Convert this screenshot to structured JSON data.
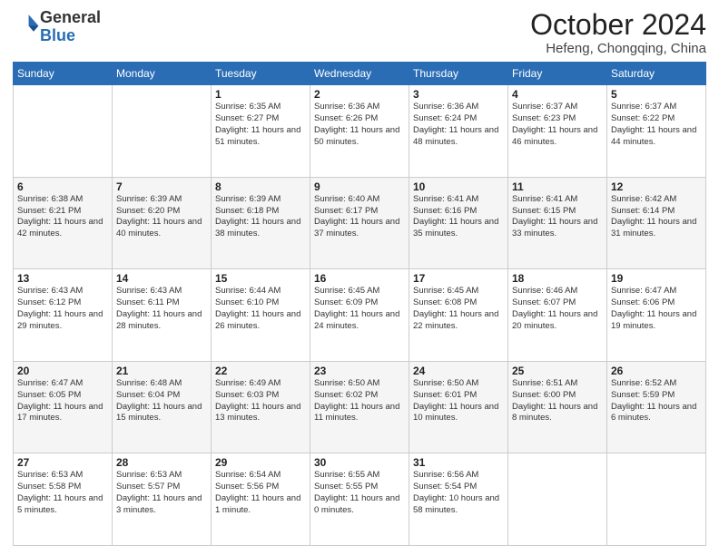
{
  "header": {
    "logo_general": "General",
    "logo_blue": "Blue",
    "month": "October 2024",
    "location": "Hefeng, Chongqing, China"
  },
  "weekdays": [
    "Sunday",
    "Monday",
    "Tuesday",
    "Wednesday",
    "Thursday",
    "Friday",
    "Saturday"
  ],
  "weeks": [
    [
      {
        "day": "",
        "info": ""
      },
      {
        "day": "",
        "info": ""
      },
      {
        "day": "1",
        "info": "Sunrise: 6:35 AM\nSunset: 6:27 PM\nDaylight: 11 hours and 51 minutes."
      },
      {
        "day": "2",
        "info": "Sunrise: 6:36 AM\nSunset: 6:26 PM\nDaylight: 11 hours and 50 minutes."
      },
      {
        "day": "3",
        "info": "Sunrise: 6:36 AM\nSunset: 6:24 PM\nDaylight: 11 hours and 48 minutes."
      },
      {
        "day": "4",
        "info": "Sunrise: 6:37 AM\nSunset: 6:23 PM\nDaylight: 11 hours and 46 minutes."
      },
      {
        "day": "5",
        "info": "Sunrise: 6:37 AM\nSunset: 6:22 PM\nDaylight: 11 hours and 44 minutes."
      }
    ],
    [
      {
        "day": "6",
        "info": "Sunrise: 6:38 AM\nSunset: 6:21 PM\nDaylight: 11 hours and 42 minutes."
      },
      {
        "day": "7",
        "info": "Sunrise: 6:39 AM\nSunset: 6:20 PM\nDaylight: 11 hours and 40 minutes."
      },
      {
        "day": "8",
        "info": "Sunrise: 6:39 AM\nSunset: 6:18 PM\nDaylight: 11 hours and 38 minutes."
      },
      {
        "day": "9",
        "info": "Sunrise: 6:40 AM\nSunset: 6:17 PM\nDaylight: 11 hours and 37 minutes."
      },
      {
        "day": "10",
        "info": "Sunrise: 6:41 AM\nSunset: 6:16 PM\nDaylight: 11 hours and 35 minutes."
      },
      {
        "day": "11",
        "info": "Sunrise: 6:41 AM\nSunset: 6:15 PM\nDaylight: 11 hours and 33 minutes."
      },
      {
        "day": "12",
        "info": "Sunrise: 6:42 AM\nSunset: 6:14 PM\nDaylight: 11 hours and 31 minutes."
      }
    ],
    [
      {
        "day": "13",
        "info": "Sunrise: 6:43 AM\nSunset: 6:12 PM\nDaylight: 11 hours and 29 minutes."
      },
      {
        "day": "14",
        "info": "Sunrise: 6:43 AM\nSunset: 6:11 PM\nDaylight: 11 hours and 28 minutes."
      },
      {
        "day": "15",
        "info": "Sunrise: 6:44 AM\nSunset: 6:10 PM\nDaylight: 11 hours and 26 minutes."
      },
      {
        "day": "16",
        "info": "Sunrise: 6:45 AM\nSunset: 6:09 PM\nDaylight: 11 hours and 24 minutes."
      },
      {
        "day": "17",
        "info": "Sunrise: 6:45 AM\nSunset: 6:08 PM\nDaylight: 11 hours and 22 minutes."
      },
      {
        "day": "18",
        "info": "Sunrise: 6:46 AM\nSunset: 6:07 PM\nDaylight: 11 hours and 20 minutes."
      },
      {
        "day": "19",
        "info": "Sunrise: 6:47 AM\nSunset: 6:06 PM\nDaylight: 11 hours and 19 minutes."
      }
    ],
    [
      {
        "day": "20",
        "info": "Sunrise: 6:47 AM\nSunset: 6:05 PM\nDaylight: 11 hours and 17 minutes."
      },
      {
        "day": "21",
        "info": "Sunrise: 6:48 AM\nSunset: 6:04 PM\nDaylight: 11 hours and 15 minutes."
      },
      {
        "day": "22",
        "info": "Sunrise: 6:49 AM\nSunset: 6:03 PM\nDaylight: 11 hours and 13 minutes."
      },
      {
        "day": "23",
        "info": "Sunrise: 6:50 AM\nSunset: 6:02 PM\nDaylight: 11 hours and 11 minutes."
      },
      {
        "day": "24",
        "info": "Sunrise: 6:50 AM\nSunset: 6:01 PM\nDaylight: 11 hours and 10 minutes."
      },
      {
        "day": "25",
        "info": "Sunrise: 6:51 AM\nSunset: 6:00 PM\nDaylight: 11 hours and 8 minutes."
      },
      {
        "day": "26",
        "info": "Sunrise: 6:52 AM\nSunset: 5:59 PM\nDaylight: 11 hours and 6 minutes."
      }
    ],
    [
      {
        "day": "27",
        "info": "Sunrise: 6:53 AM\nSunset: 5:58 PM\nDaylight: 11 hours and 5 minutes."
      },
      {
        "day": "28",
        "info": "Sunrise: 6:53 AM\nSunset: 5:57 PM\nDaylight: 11 hours and 3 minutes."
      },
      {
        "day": "29",
        "info": "Sunrise: 6:54 AM\nSunset: 5:56 PM\nDaylight: 11 hours and 1 minute."
      },
      {
        "day": "30",
        "info": "Sunrise: 6:55 AM\nSunset: 5:55 PM\nDaylight: 11 hours and 0 minutes."
      },
      {
        "day": "31",
        "info": "Sunrise: 6:56 AM\nSunset: 5:54 PM\nDaylight: 10 hours and 58 minutes."
      },
      {
        "day": "",
        "info": ""
      },
      {
        "day": "",
        "info": ""
      }
    ]
  ]
}
